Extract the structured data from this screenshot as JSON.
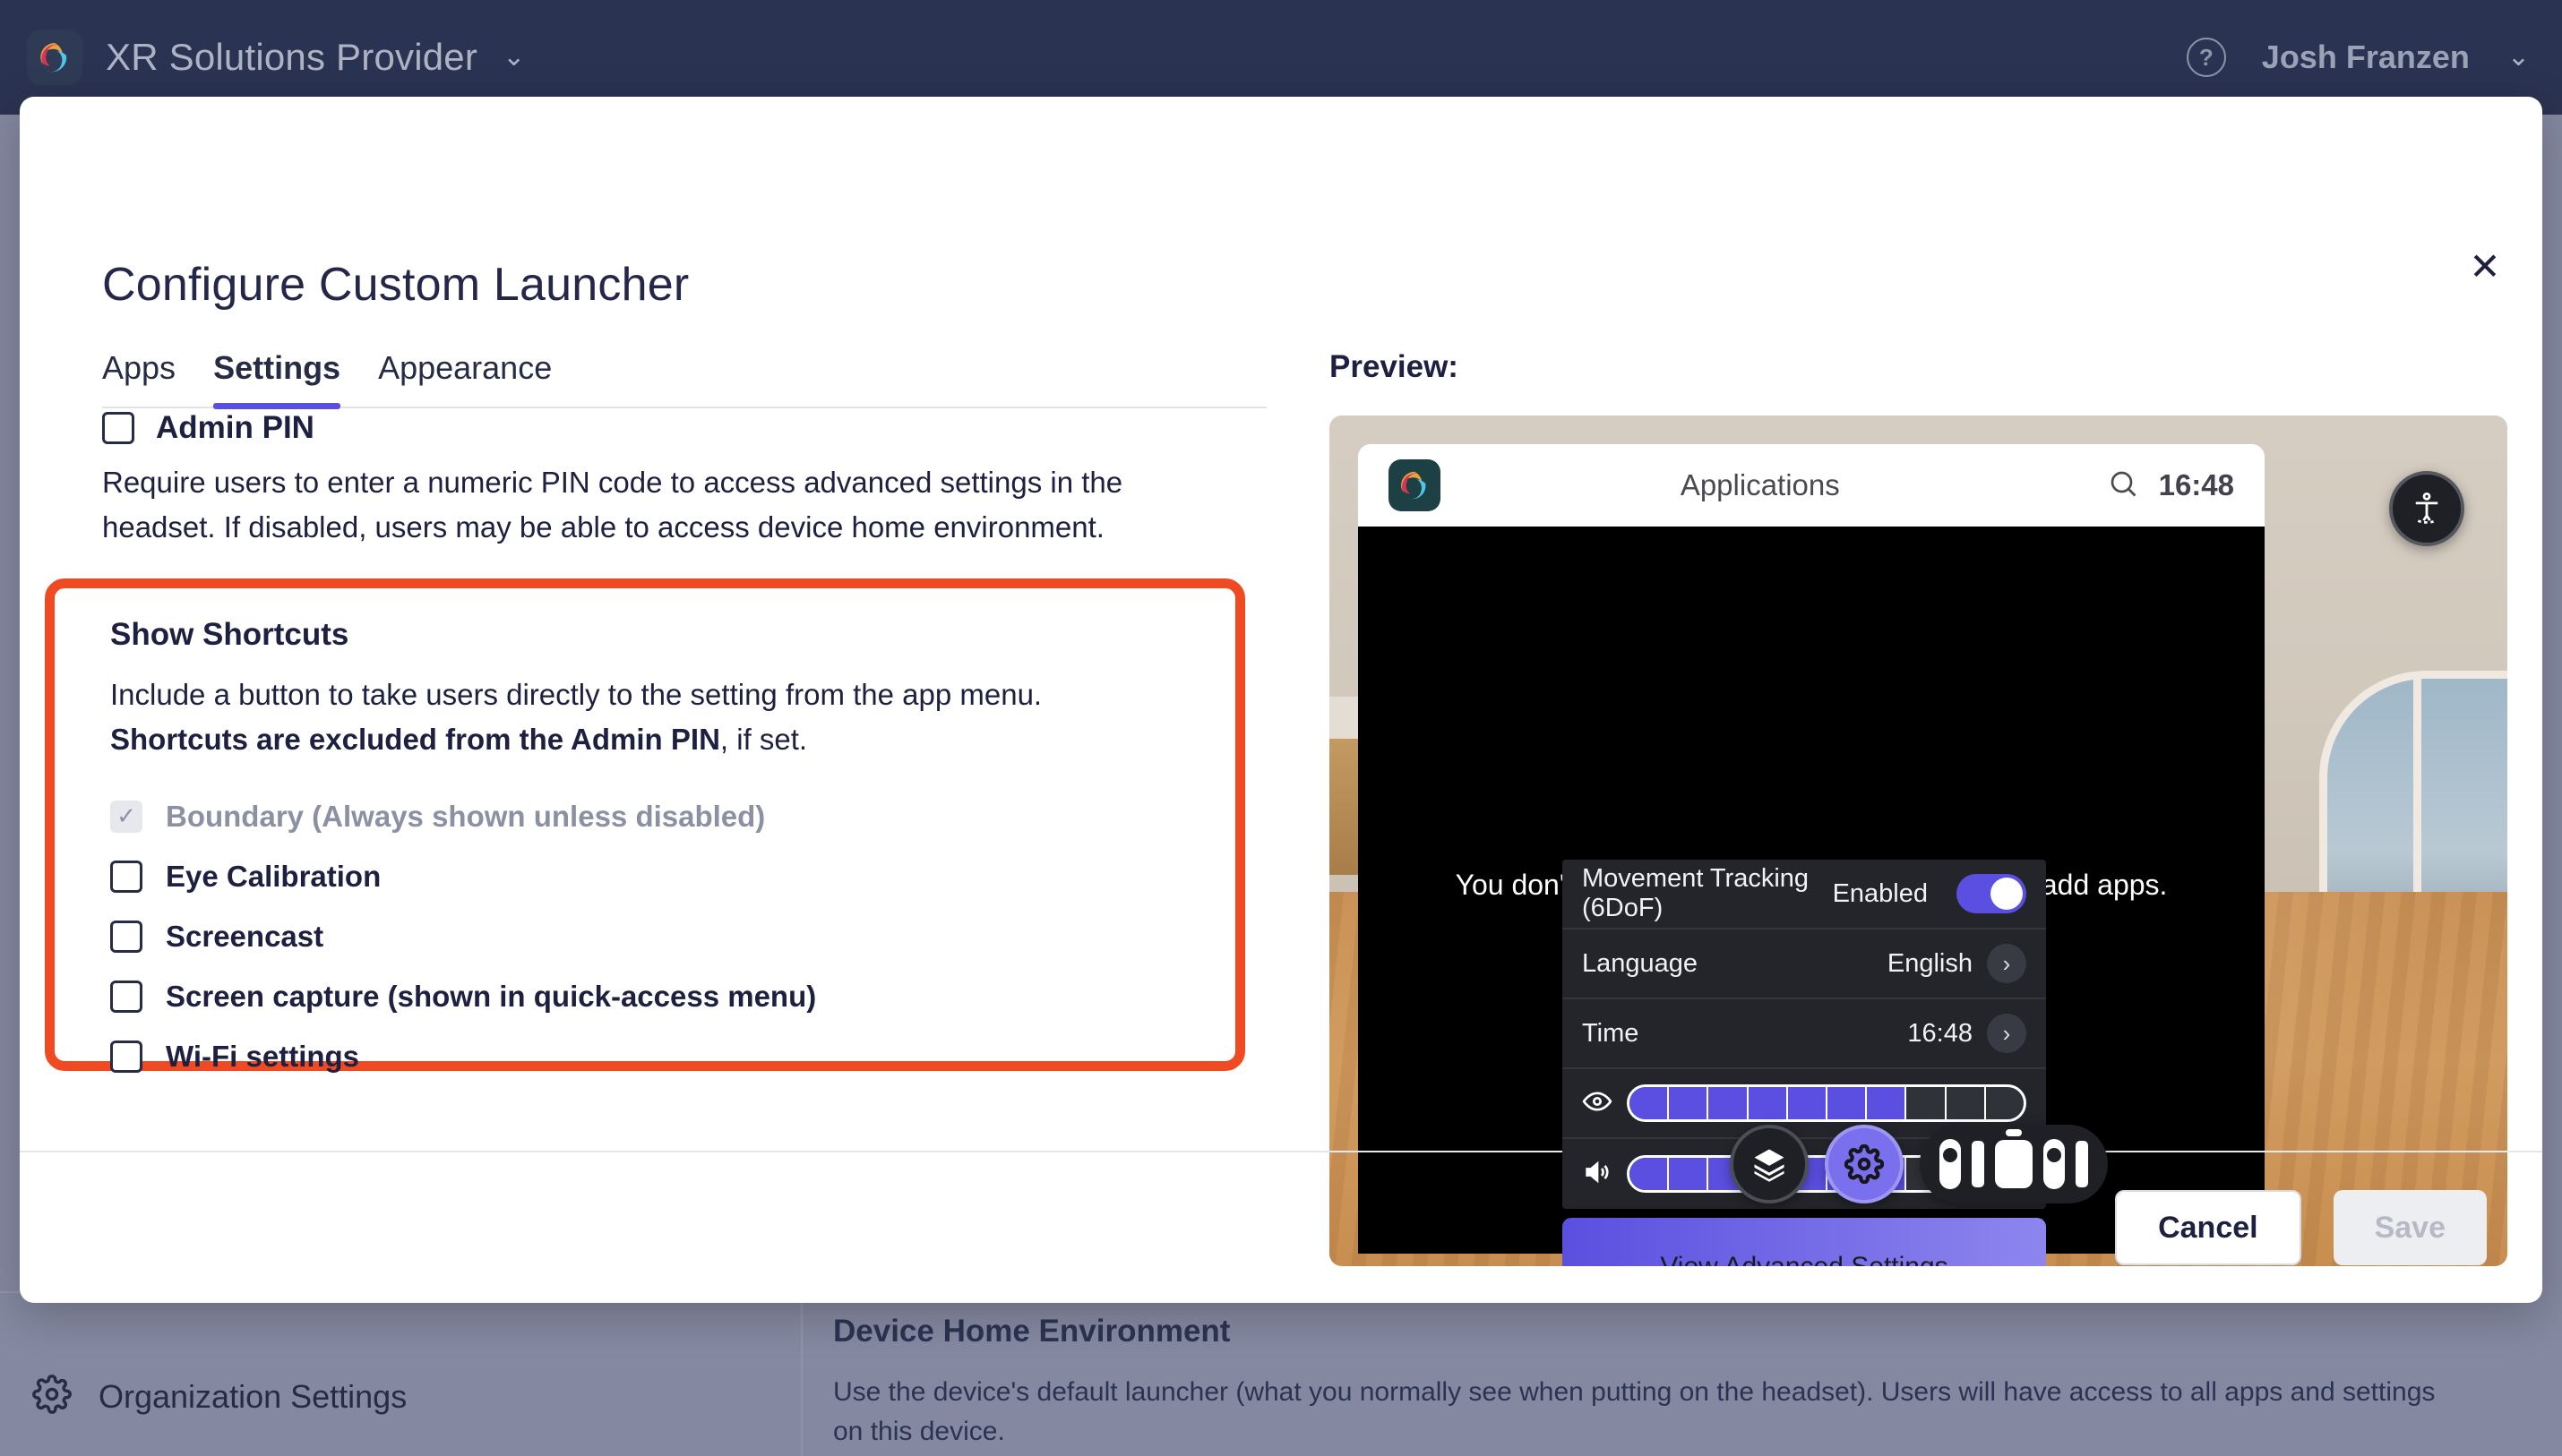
{
  "topbar": {
    "brand_name": "XR Solutions Provider",
    "brand_caret": "⌄",
    "help_glyph": "?",
    "user_name": "Josh Franzen",
    "user_caret": "⌄"
  },
  "background": {
    "org_settings_label": "Organization Settings",
    "section_title": "Device Home Environment",
    "section_body": "Use the device's default launcher (what you normally see when putting on the headset). Users will have access to all apps and settings on this device."
  },
  "modal": {
    "title": "Configure Custom Launcher",
    "close_glyph": "✕",
    "tabs": [
      {
        "label": "Apps",
        "active": false
      },
      {
        "label": "Settings",
        "active": true
      },
      {
        "label": "Appearance",
        "active": false
      }
    ],
    "admin_pin": {
      "label": "Admin PIN",
      "checked": false,
      "description": "Require users to enter a numeric PIN code to access advanced settings in the headset. If disabled, users may be able to access device home environment."
    },
    "show_shortcuts": {
      "title": "Show Shortcuts",
      "description_lead": "Include a button to take users directly to the setting from the app menu. ",
      "description_bold": "Shortcuts are excluded from the Admin PIN",
      "description_tail": ", if set.",
      "highlight_color": "#f04a22",
      "items": [
        {
          "label": "Boundary (Always shown unless disabled)",
          "checked": true,
          "disabled": true
        },
        {
          "label": "Eye Calibration",
          "checked": false,
          "disabled": false
        },
        {
          "label": "Screencast",
          "checked": false,
          "disabled": false
        },
        {
          "label": "Screen capture (shown in quick-access menu)",
          "checked": false,
          "disabled": false
        },
        {
          "label": "Wi-Fi settings",
          "checked": false,
          "disabled": false
        }
      ]
    },
    "footer": {
      "cancel_label": "Cancel",
      "save_label": "Save"
    }
  },
  "preview": {
    "label": "Preview:",
    "launcher": {
      "title": "Applications",
      "time": "16:48",
      "empty_text": "You don't have any apps. Use the Apps tab to add apps."
    },
    "settings_popup": {
      "rows": [
        {
          "label": "Movement Tracking (6DoF)",
          "value": "Enabled",
          "type": "toggle",
          "on": true
        },
        {
          "label": "Language",
          "value": "English",
          "type": "chevron"
        },
        {
          "label": "Time",
          "value": "16:48",
          "type": "chevron"
        },
        {
          "label": "Brightness",
          "icon": "eye-icon",
          "type": "slider",
          "filled": 7,
          "total": 10
        },
        {
          "label": "Volume",
          "icon": "speaker-icon",
          "type": "slider",
          "filled": 7,
          "total": 10
        }
      ],
      "advanced_button": "View Advanced Settings"
    },
    "accent_color": "#5a4fe0"
  }
}
